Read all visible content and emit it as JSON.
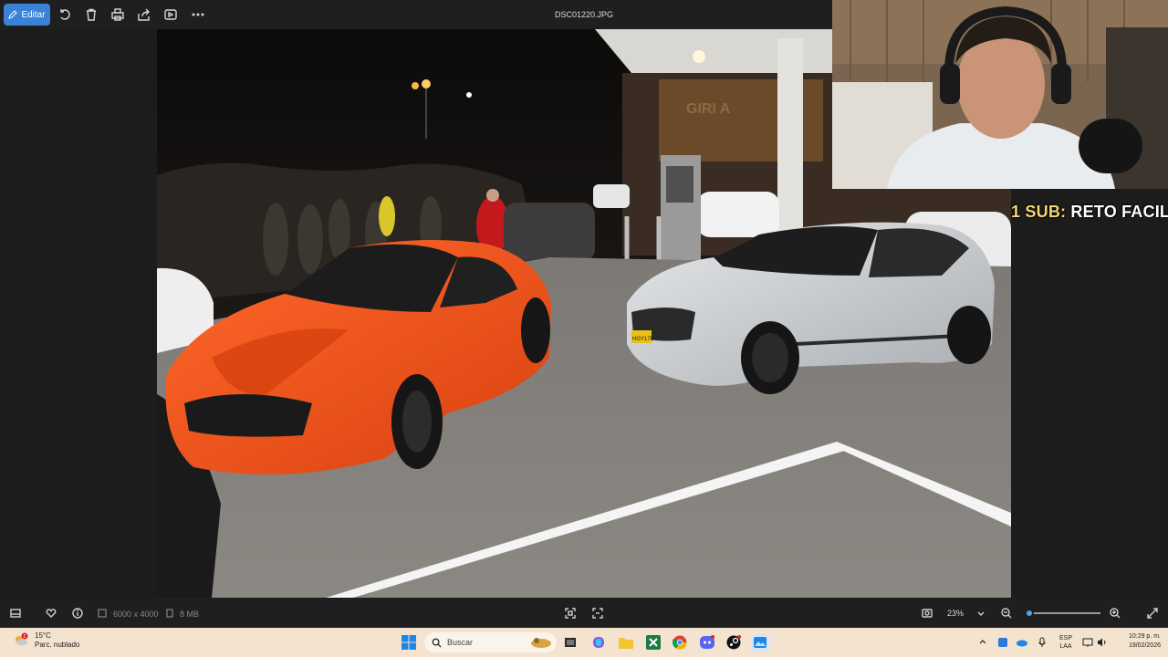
{
  "toolbar": {
    "edit_label": "Editar",
    "filename": "DSC01220.JPG"
  },
  "overlay": {
    "sub_goal_prefix": "1 SUB:",
    "sub_goal_text": "RETO FACIL"
  },
  "statusbar": {
    "dimensions": "6000 x 4000",
    "file_size": "8 MB",
    "zoom": "23%",
    "zoom_level": 0.05
  },
  "taskbar": {
    "weather_temp": "15°C",
    "weather_desc": "Parc. nublado",
    "weather_badge": "2",
    "search_placeholder": "Buscar",
    "lang_line1": "ESP",
    "lang_line2": "LAA",
    "time": "10:29 p. m.",
    "date": "19/02/2026"
  },
  "photo_sign_text": "GIRI A",
  "plate_text": "HGY178",
  "colors": {
    "accent": "#3b82d6",
    "mustang": "#f2521c",
    "mercedes": "#c8cbcf",
    "taskbar": "#f3e3cf"
  }
}
